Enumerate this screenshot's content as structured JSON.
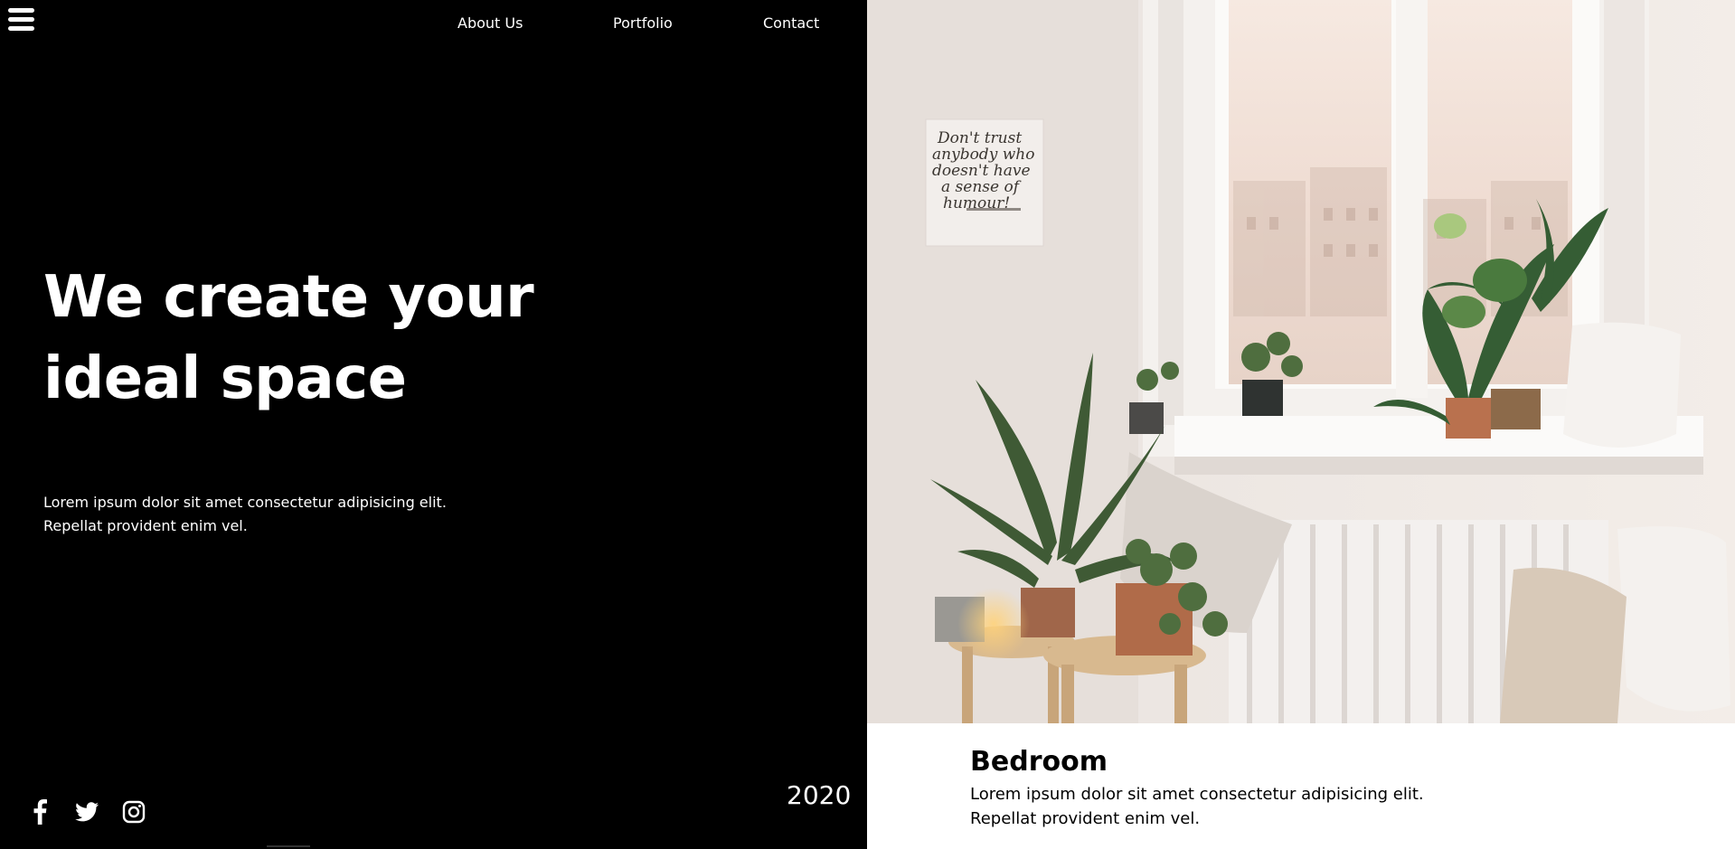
{
  "nav": {
    "items": [
      "About Us",
      "Portfolio",
      "Contact"
    ]
  },
  "hero": {
    "title_line1": "We create your",
    "title_line2": "ideal space",
    "description_line1": "Lorem ipsum dolor sit amet consectetur adipisicing elit.",
    "description_line2": "Repellat provident enim vel."
  },
  "footer": {
    "year": "2020",
    "social_icons": [
      "facebook-icon",
      "twitter-icon",
      "instagram-icon"
    ]
  },
  "feature": {
    "poster_text": [
      "Don't trust",
      "anybody who",
      "doesn't have",
      "a sense of",
      "humour!"
    ],
    "caption_title": "Bedroom",
    "caption_line1": "Lorem ipsum dolor sit amet consectetur adipisicing elit.",
    "caption_line2": "Repellat provident enim vel."
  },
  "colors": {
    "background": "#000000",
    "text": "#ffffff",
    "caption_background": "#ffffff",
    "caption_text": "#000000"
  }
}
